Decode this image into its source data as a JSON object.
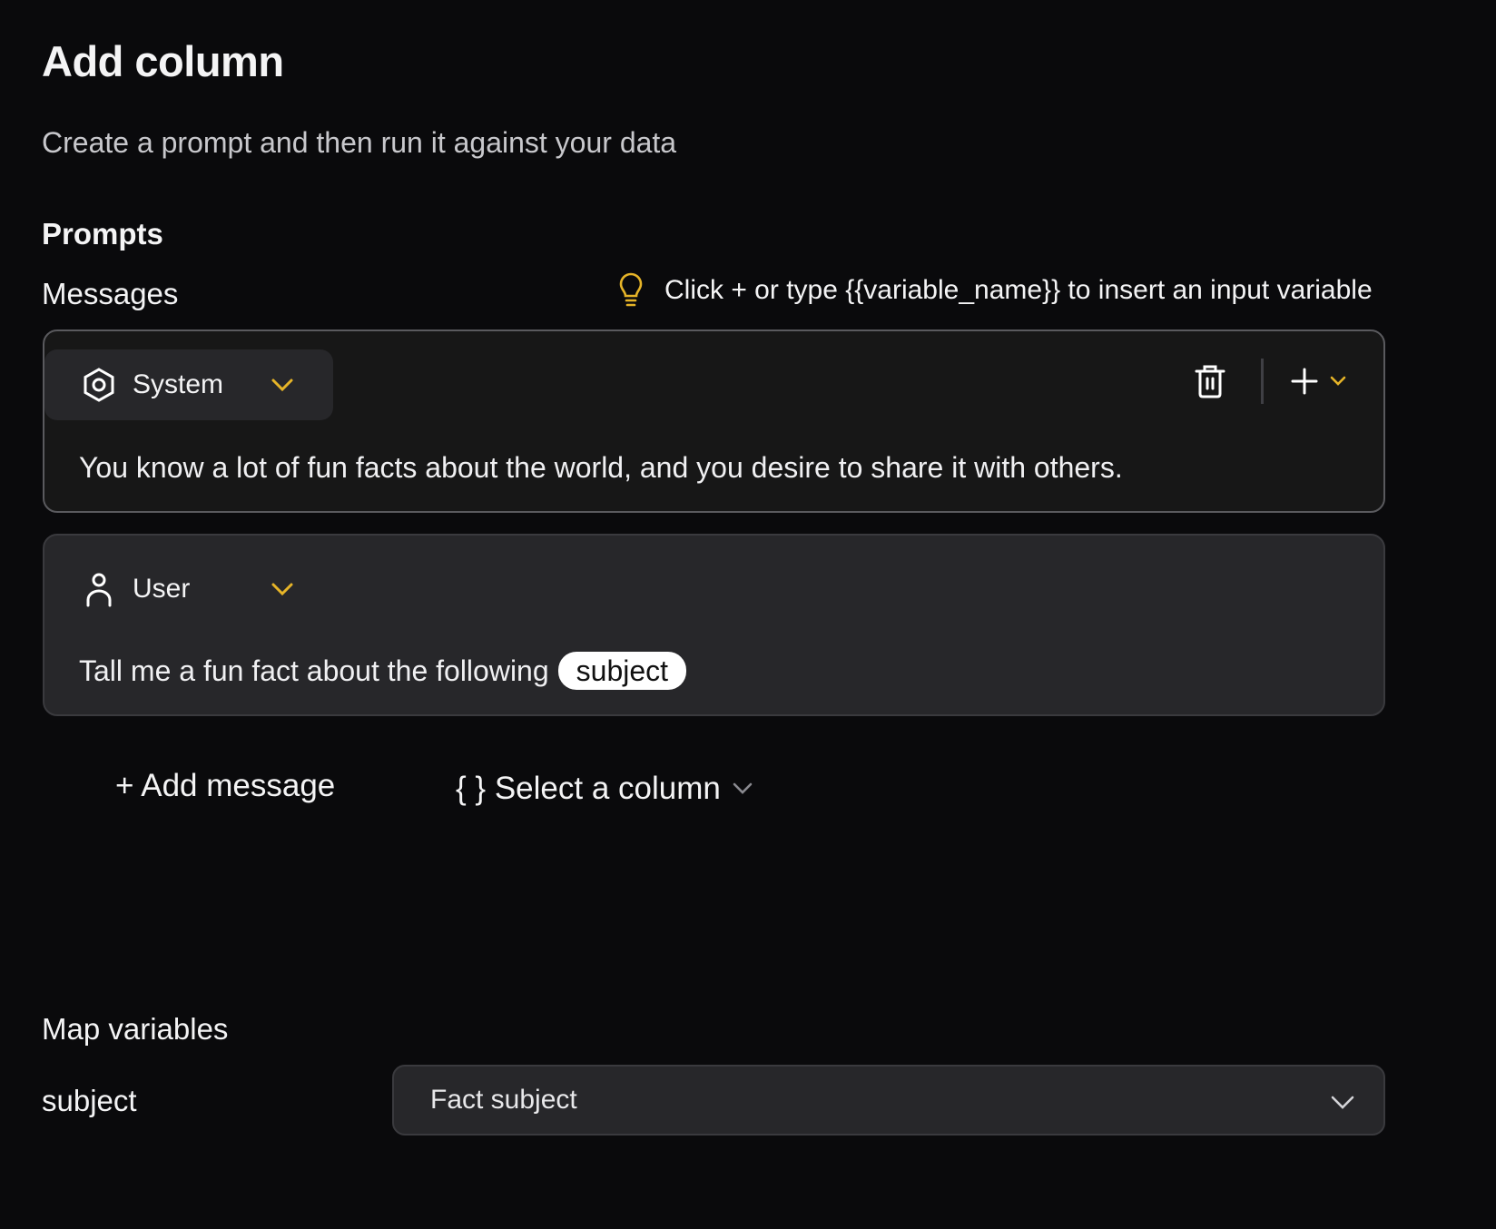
{
  "header": {
    "title": "Add column",
    "subtitle": "Create a prompt and then run it against your data"
  },
  "prompts": {
    "heading": "Prompts",
    "messages_label": "Messages",
    "hint": "Click + or type {{variable_name}} to insert an input variable",
    "hint_icon": "lightbulb-icon",
    "messages": [
      {
        "role": "System",
        "role_icon": "hexagon-settings-icon",
        "text": "You know a lot of fun facts about the world, and you desire to share it with others."
      },
      {
        "role": "User",
        "role_icon": "user-icon",
        "text": "Tall me a fun fact about the following",
        "variable": "subject"
      }
    ],
    "add_message_label": "+ Add message",
    "select_column_label": "{ } Select a column"
  },
  "map_variables": {
    "heading": "Map variables",
    "rows": [
      {
        "variable": "subject",
        "selected": "Fact subject"
      }
    ]
  },
  "colors": {
    "accent": "#e6b428",
    "background": "#0a0a0c",
    "card": "#27272a"
  }
}
